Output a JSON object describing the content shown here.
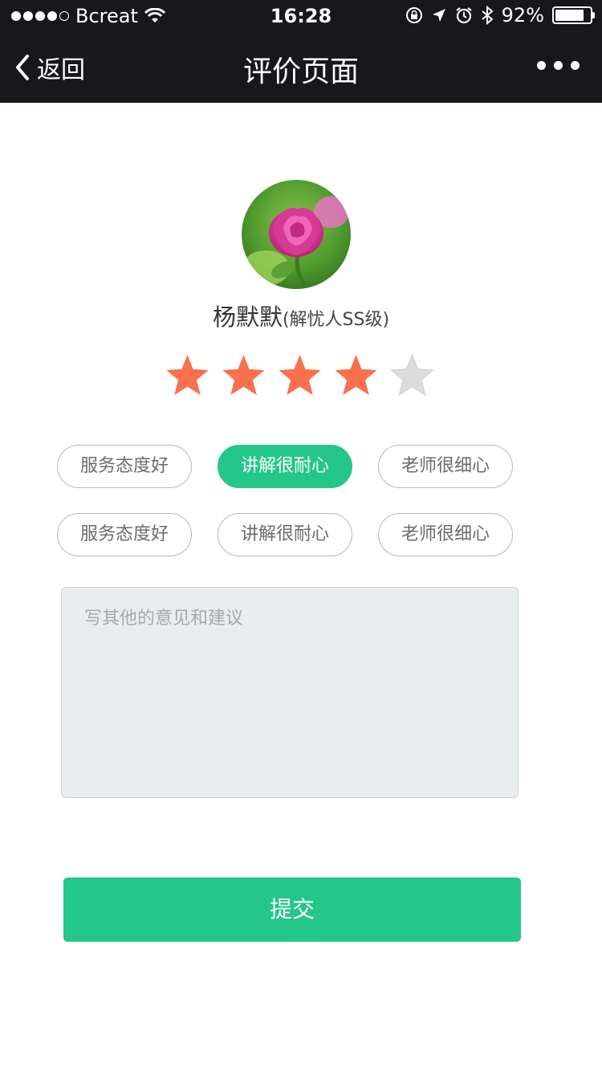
{
  "status_bar": {
    "carrier": "Bcreat",
    "time": "16:28",
    "battery_percent": "92%",
    "battery_level": 0.92,
    "icons": [
      "signal-dots",
      "wifi-icon",
      "rotation-lock-icon",
      "location-icon",
      "alarm-icon",
      "bluetooth-icon",
      "battery-icon"
    ]
  },
  "nav": {
    "back_label": "返回",
    "title": "评价页面",
    "more_icon": "more-dots-icon"
  },
  "teacher": {
    "name": "杨默默",
    "level": "(解忧人SS级)",
    "avatar": "rose-photo"
  },
  "rating": {
    "value": 4,
    "max": 5,
    "filled_color": "#f7714e",
    "empty_color": "#dcdcdc"
  },
  "tags": [
    {
      "label": "服务态度好",
      "selected": false
    },
    {
      "label": "讲解很耐心",
      "selected": true
    },
    {
      "label": "老师很细心",
      "selected": false
    },
    {
      "label": "服务态度好",
      "selected": false
    },
    {
      "label": "讲解很耐心",
      "selected": false
    },
    {
      "label": "老师很细心",
      "selected": false
    }
  ],
  "comment": {
    "placeholder": "写其他的意见和建议",
    "value": ""
  },
  "submit_label": "提交",
  "colors": {
    "accent": "#24c789",
    "bar": "#18171c"
  }
}
